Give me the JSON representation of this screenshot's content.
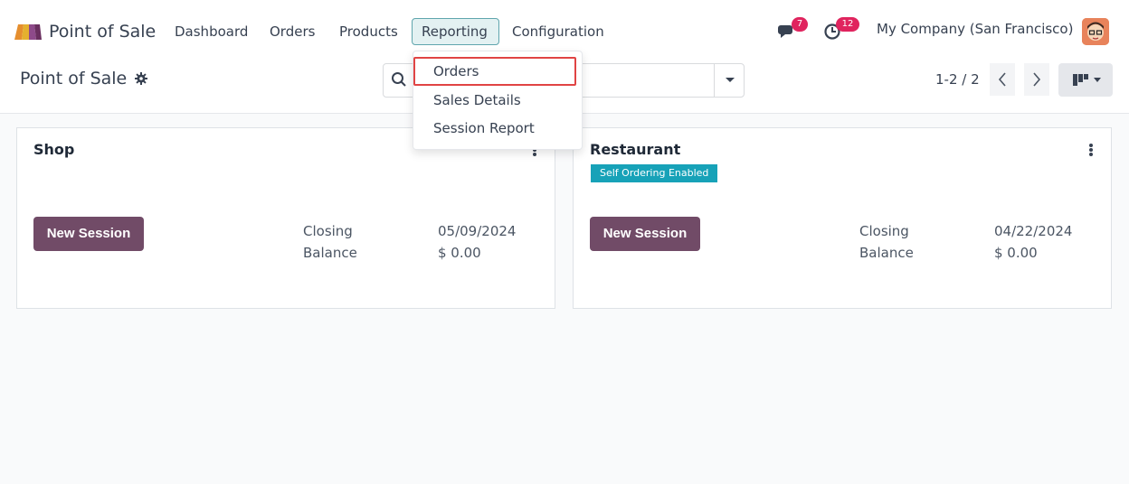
{
  "navbar": {
    "app_name": "Point of Sale",
    "menu": [
      "Dashboard",
      "Orders",
      "Products",
      "Reporting",
      "Configuration"
    ],
    "active_menu": "Reporting",
    "messages_count": "7",
    "activities_count": "12",
    "company": "My Company (San Francisco)"
  },
  "control_panel": {
    "title": "Point of Sale",
    "pager": "1-2 / 2"
  },
  "reporting_menu": {
    "items": [
      "Orders",
      "Sales Details",
      "Session Report"
    ],
    "highlighted": "Orders"
  },
  "cards": [
    {
      "name": "Shop",
      "tag": "",
      "button": "New Session",
      "label_1": "Closing",
      "label_2": "Balance",
      "value_1": "05/09/2024",
      "value_2": "$ 0.00"
    },
    {
      "name": "Restaurant",
      "tag": "Self Ordering Enabled",
      "button": "New Session",
      "label_1": "Closing",
      "label_2": "Balance",
      "value_1": "04/22/2024",
      "value_2": "$ 0.00"
    }
  ],
  "colors": {
    "primary": "#714b67",
    "tag": "#17a2b8",
    "badge": "#e0245e",
    "highlight_border": "#e04444"
  }
}
